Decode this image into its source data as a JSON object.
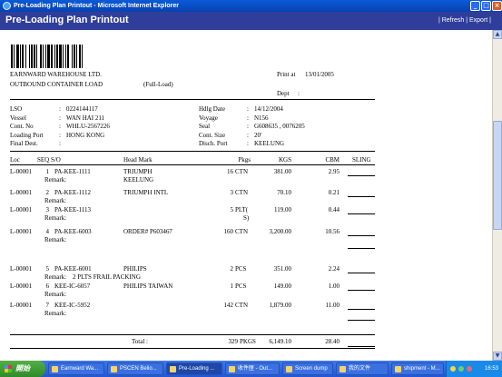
{
  "window": {
    "title": "Pre-Loading Plan Printout - Microsoft Internet Explorer"
  },
  "header": {
    "title": "Pre-Loading Plan Printout",
    "refresh": "Refresh",
    "export": "Export",
    "sep": "|"
  },
  "company": {
    "name": "EARNWARD WAREHOUSE LTD.",
    "load_type": "OUTBOUND CONTAINER LOAD",
    "full": "(Full-Load)",
    "print_label": "Print at",
    "print_date": "13/01/2005",
    "dept_label": "Dept",
    "dept_value": ":"
  },
  "info_left": [
    {
      "label": "LSO",
      "value": "0224144117"
    },
    {
      "label": "Vessel",
      "value": "WAN HAI 211"
    },
    {
      "label": "Cont. No",
      "value": "WHLU-2567226"
    },
    {
      "label": "Loading Port",
      "value": "HONG KONG"
    },
    {
      "label": "Final Dest.",
      "value": ""
    }
  ],
  "info_right": [
    {
      "label": "Hdlg Date",
      "value": "14/12/2004"
    },
    {
      "label": "Voyage",
      "value": "N156"
    },
    {
      "label": "Seal",
      "value": "G608635 , 0076205"
    },
    {
      "label": "Cont. Size",
      "value": "20'"
    },
    {
      "label": "Disch. Port",
      "value": "KEELUNG"
    }
  ],
  "colon": ":",
  "columns": {
    "loc": "Loc",
    "seq": "SEQ S/O",
    "headmark": "Head Mark",
    "pkgs": "Pkgs",
    "kgs": "KGS",
    "cbm": "CBM",
    "sling": "SLING"
  },
  "remark_label": "Remark:",
  "rows": [
    {
      "loc": "L-00001",
      "seq": "1",
      "so": "PA-KEE-1111",
      "headmark": "TRIUMPH",
      "headmark2": "KEELUNG",
      "pkgs": "16",
      "unit": "CTN",
      "unit2": "",
      "kgs": "381.00",
      "cbm": "2.95",
      "remark": ""
    },
    {
      "loc": "L-00001",
      "seq": "2",
      "so": "PA-KEE-1112",
      "headmark": "TRIUMPH INTL",
      "headmark2": "",
      "pkgs": "3",
      "unit": "CTN",
      "unit2": "",
      "kgs": "70.10",
      "cbm": "0.21",
      "remark": ""
    },
    {
      "loc": "L-00001",
      "seq": "3",
      "so": "PA-KEE-1113",
      "headmark": "",
      "headmark2": "",
      "pkgs": "5",
      "unit": "PLT(",
      "unit2": "S)",
      "kgs": "119.00",
      "cbm": "0.44",
      "remark": ""
    },
    {
      "loc": "L-00001",
      "seq": "4",
      "so": "PA-KEE-6003",
      "headmark": "ORDER# P603467",
      "headmark2": "",
      "pkgs": "160",
      "unit": "CTN",
      "unit2": "",
      "kgs": "3,200.00",
      "cbm": "10.56",
      "remark": ""
    },
    {
      "loc": "L-00001",
      "seq": "5",
      "so": "PA-KEE-6001",
      "headmark": "PHILIPS",
      "headmark2": "",
      "pkgs": "2",
      "unit": "PCS",
      "unit2": "",
      "kgs": "351.00",
      "cbm": "2.24",
      "remark": "2 PLTS FRAIL PACKING"
    },
    {
      "loc": "L-00001",
      "seq": "6",
      "so": "KEE-IC-6057",
      "headmark": "PHILIPS TAIWAN",
      "headmark2": "",
      "pkgs": "1",
      "unit": "PCS",
      "unit2": "",
      "kgs": "149.00",
      "cbm": "1.00",
      "remark": ""
    },
    {
      "loc": "L-00001",
      "seq": "7",
      "so": "KEE-IC-5952",
      "headmark": "",
      "headmark2": "",
      "pkgs": "142",
      "unit": "CTN",
      "unit2": "",
      "kgs": "1,879.00",
      "cbm": "11.00",
      "remark": ""
    }
  ],
  "total": {
    "label": "Total :",
    "pkgs": "329",
    "unit": "PKGS",
    "kgs": "6,149.10",
    "cbm": "28.40"
  },
  "taskbar": {
    "start": "開始",
    "items": [
      "Earnward Wa...",
      "PSCEN Belio...",
      "Pre-Loading ...",
      "收件匣 - Out...",
      "Screen dump",
      "我的文件",
      "shipment - M..."
    ],
    "clock": "16:53"
  }
}
